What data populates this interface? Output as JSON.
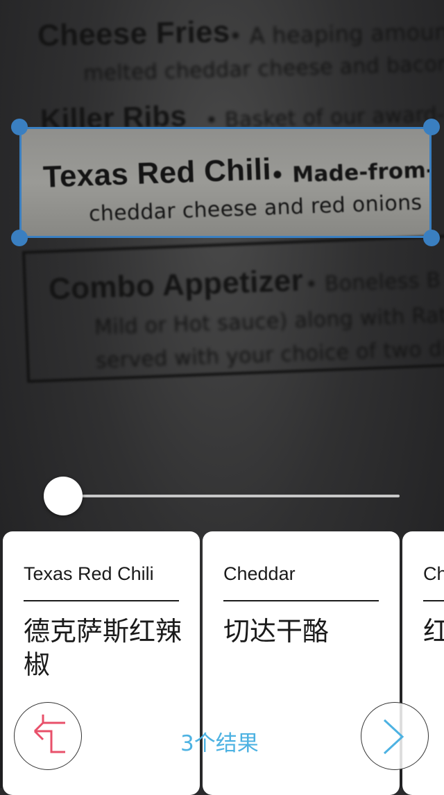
{
  "camera": {
    "menu_lines": [
      "Cheese Fries",
      "• A heaping amount",
      "melted cheddar cheese and bacon",
      "Killer Ribs",
      "• Basket of our award-w",
      "Texas Red Chili",
      "• Made-from-s",
      "cheddar cheese and red onions",
      "Combo Appetizer",
      "• Boneless B",
      "Mild or Hot sauce) along with Ratt",
      "served with your choice of two dip"
    ]
  },
  "selection": {
    "color": "#3a7fc1"
  },
  "slider": {
    "value_fraction": 0.0
  },
  "cards": [
    {
      "source": "Texas Red Chili",
      "translation": "德克萨斯红辣椒"
    },
    {
      "source": "Cheddar",
      "translation": "切达干酪"
    },
    {
      "source": "Ch",
      "translation": "红"
    }
  ],
  "footer": {
    "results_label": "3个结果",
    "back_icon": "back-arrow-icon",
    "next_icon": "chevron-right-icon",
    "back_color": "#e8506a",
    "next_color": "#4db2e2"
  }
}
